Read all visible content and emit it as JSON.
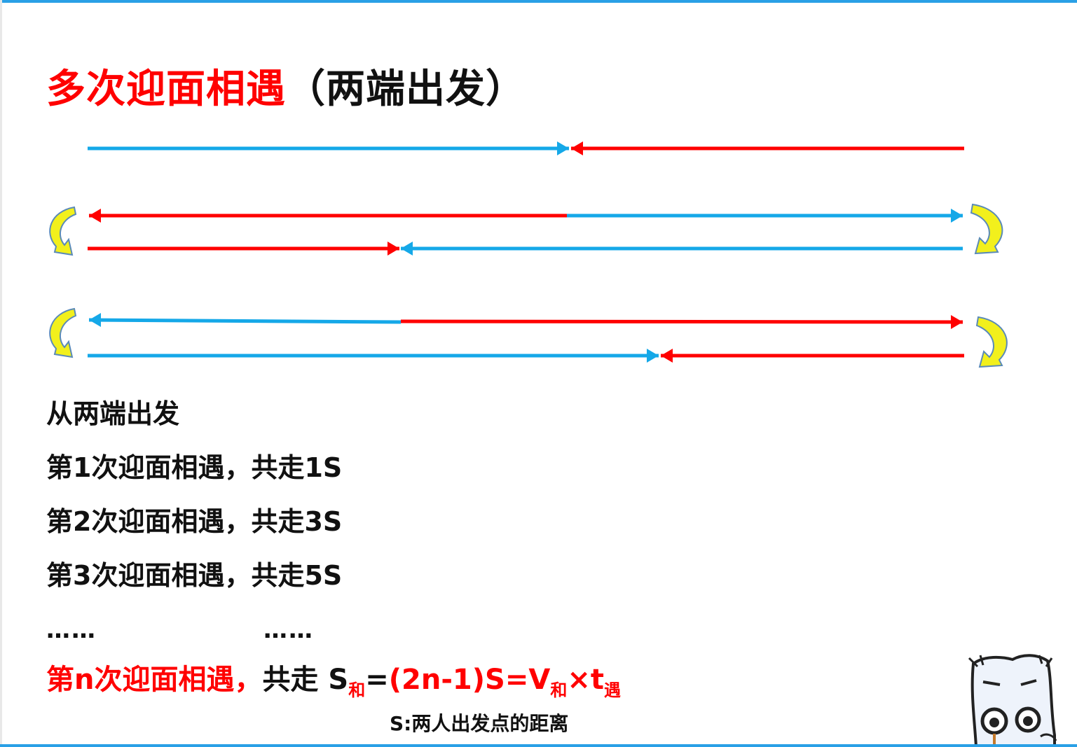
{
  "title": {
    "main": "多次迎面相遇",
    "sub": "（两端出发）"
  },
  "colors": {
    "person_a": "#15a8e8",
    "person_b": "#ff0000",
    "turn_arrow_fill": "#f2f01c",
    "turn_arrow_stroke": "#5a8ab8"
  },
  "steps": [
    "从两端出发",
    "第1次迎面相遇，共走1S",
    "第2次迎面相遇，共走3S",
    "第3次迎面相遇，共走5S"
  ],
  "ellipsis": {
    "left": "……",
    "right": "……"
  },
  "formula": {
    "lead": "第n次迎面相遇，",
    "mid": "共走 S",
    "sub_he": "和",
    "eq1": "=",
    "expr": "(2n-1)S=V",
    "sub_he2": "和",
    "times": "×t",
    "sub_yu": "遇"
  },
  "note": "S:两人出发点的距离"
}
